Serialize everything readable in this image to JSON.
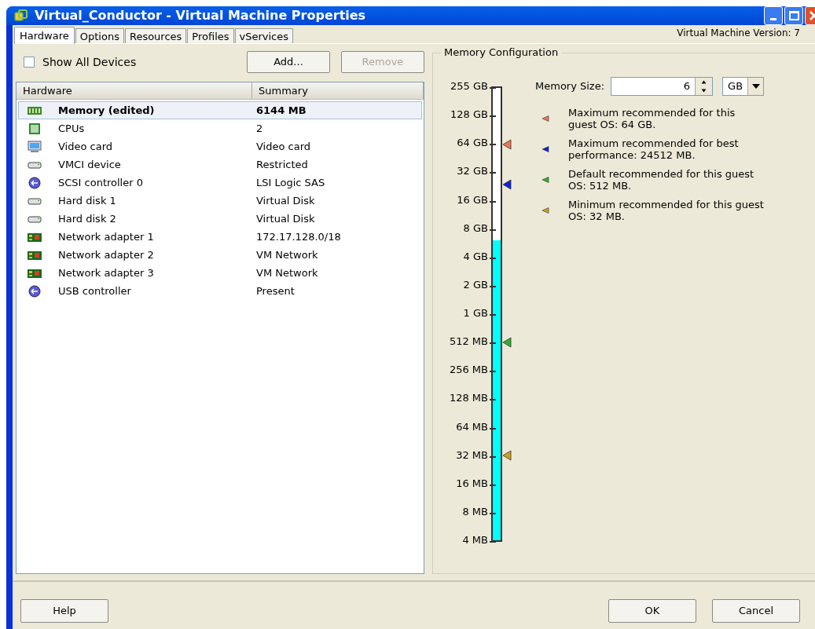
{
  "window": {
    "title": "Virtual_Conductor - Virtual Machine Properties"
  },
  "tabs": [
    {
      "label": "Hardware",
      "selected": true
    },
    {
      "label": "Options",
      "selected": false
    },
    {
      "label": "Resources",
      "selected": false
    },
    {
      "label": "Profiles",
      "selected": false
    },
    {
      "label": "vServices",
      "selected": false
    }
  ],
  "version": "Virtual Machine Version: 7",
  "show_all_devices": {
    "label": "Show All Devices",
    "checked": false
  },
  "buttons": [
    {
      "label": "Add...",
      "disabled": false
    },
    {
      "label": "Remove",
      "disabled": true
    }
  ],
  "table": {
    "columns": [
      "Hardware",
      "Summary"
    ],
    "rows": [
      {
        "kind": "memory",
        "name": "Memory (edited)",
        "summary": "6144 MB",
        "selected": true
      },
      {
        "kind": "cpu",
        "name": "CPUs",
        "summary": "2",
        "selected": false
      },
      {
        "kind": "monitor",
        "name": "Video card",
        "summary": "Video card",
        "selected": false
      },
      {
        "kind": "drive",
        "name": "VMCI device",
        "summary": "Restricted",
        "selected": false
      },
      {
        "kind": "controller",
        "name": "SCSI controller 0",
        "summary": "LSI Logic SAS",
        "selected": false
      },
      {
        "kind": "drive",
        "name": "Hard disk 1",
        "summary": "Virtual Disk",
        "selected": false
      },
      {
        "kind": "drive",
        "name": "Hard disk 2",
        "summary": "Virtual Disk",
        "selected": false
      },
      {
        "kind": "network",
        "name": "Network adapter 1",
        "summary": "172.17.128.0/18",
        "selected": false
      },
      {
        "kind": "network",
        "name": "Network adapter 2",
        "summary": "VM Network",
        "selected": false
      },
      {
        "kind": "network",
        "name": "Network adapter 3",
        "summary": "VM Network",
        "selected": false
      },
      {
        "kind": "controller",
        "name": "USB controller",
        "summary": "Present",
        "selected": false
      }
    ]
  },
  "memory_configuration": {
    "title": "Memory Configuration",
    "scale_labels": [
      "255 GB",
      "128 GB",
      "64 GB",
      "32 GB",
      "16 GB",
      "8 GB",
      "4 GB",
      "2 GB",
      "1 GB",
      "512 MB",
      "256 MB",
      "128 MB",
      "64 MB",
      "32 MB",
      "16 MB",
      "8 MB",
      "4 MB"
    ],
    "level": 0.663,
    "memory_size": {
      "label": "Memory Size:",
      "value": "6",
      "unit": "GB"
    },
    "scale_markers": [
      {
        "color": "#f07850",
        "level": 0.875
      },
      {
        "color": "#1020e0",
        "level": 0.786
      },
      {
        "color": "#30b030",
        "level": 0.4375
      },
      {
        "color": "#d0a020",
        "level": 0.1875
      }
    ],
    "legend": [
      {
        "text": "Maximum recommended for this guest OS: 64 GB.",
        "color": "#f07850"
      },
      {
        "text": "Maximum recommended for best performance: 24512 MB.",
        "color": "#1020e0"
      },
      {
        "text": "Default recommended for this guest OS: 512 MB.",
        "color": "#30b030"
      },
      {
        "text": "Minimum recommended for this guest OS: 32 MB.",
        "color": "#d0a020"
      }
    ]
  },
  "help_button": "Help",
  "dialog_buttons": [
    "OK",
    "Cancel"
  ]
}
